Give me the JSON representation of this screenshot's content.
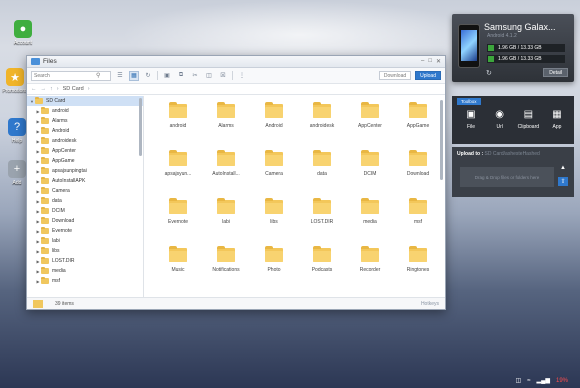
{
  "desktop": {
    "icons": [
      {
        "label": "Account",
        "color": "#3fae3f",
        "icon": "person-icon"
      },
      {
        "label": "Promotions",
        "color": "#f0b429",
        "icon": "star-icon"
      },
      {
        "label": "Help",
        "color": "#2f78cc",
        "icon": "help-icon"
      },
      {
        "label": "Add",
        "color": "#9aa3ae",
        "icon": "plus-icon"
      }
    ]
  },
  "window": {
    "title": "Files",
    "search_placeholder": "Search",
    "download_label": "Download",
    "upload_label": "Upload",
    "path": "SD Card",
    "status_count": "39 items",
    "hotkeys_label": "Hotkeys"
  },
  "tree": [
    {
      "label": "SD Card",
      "expanded": true,
      "selected": true,
      "level": 0
    },
    {
      "label": "android",
      "level": 1
    },
    {
      "label": "Alarms",
      "level": 1
    },
    {
      "label": "Android",
      "level": 1
    },
    {
      "label": "androidesk",
      "level": 1
    },
    {
      "label": "AppCenter",
      "level": 1
    },
    {
      "label": "AppGame",
      "level": 1
    },
    {
      "label": "apsajsunpingtai",
      "level": 1
    },
    {
      "label": "AutoInstallAPK",
      "level": 1
    },
    {
      "label": "Camera",
      "level": 1
    },
    {
      "label": "data",
      "level": 1
    },
    {
      "label": "DCIM",
      "level": 1
    },
    {
      "label": "Download",
      "level": 1
    },
    {
      "label": "Evernote",
      "level": 1
    },
    {
      "label": "labi",
      "level": 1
    },
    {
      "label": "libs",
      "level": 1
    },
    {
      "label": "LOST.DIR",
      "level": 1
    },
    {
      "label": "media",
      "level": 1
    },
    {
      "label": "msf",
      "level": 1
    }
  ],
  "folders": [
    "android",
    "Alarms",
    "Android",
    "androidesk",
    "AppCenter",
    "AppGame",
    "apsajsyun...",
    "AutoInstall...",
    "Camera",
    "data",
    "DCIM",
    "Download",
    "Evernote",
    "labi",
    "libs",
    "LOST.DIR",
    "media",
    "msf",
    "Music",
    "Notifications",
    "Photo",
    "Podcasts",
    "Recorder",
    "Ringtones"
  ],
  "device": {
    "name": "Samsung Galax...",
    "os": "Android 4.1.2",
    "storage1": "1.96 GB / 13.33 GB",
    "storage2": "1.96 GB / 13.33 GB",
    "detail_label": "Detail"
  },
  "toolbox": {
    "title": "Toolbox",
    "tools": [
      {
        "label": "File",
        "icon": "file-icon"
      },
      {
        "label": "Url",
        "icon": "globe-icon"
      },
      {
        "label": "Clipboard",
        "icon": "clipboard-icon"
      },
      {
        "label": "App",
        "icon": "app-icon"
      }
    ]
  },
  "upload": {
    "label": "Upload to :",
    "path": "SD Card/ashesteHashed",
    "drop_text": "Drag & Drop files or folders here"
  },
  "tray": {
    "battery": "19%"
  }
}
